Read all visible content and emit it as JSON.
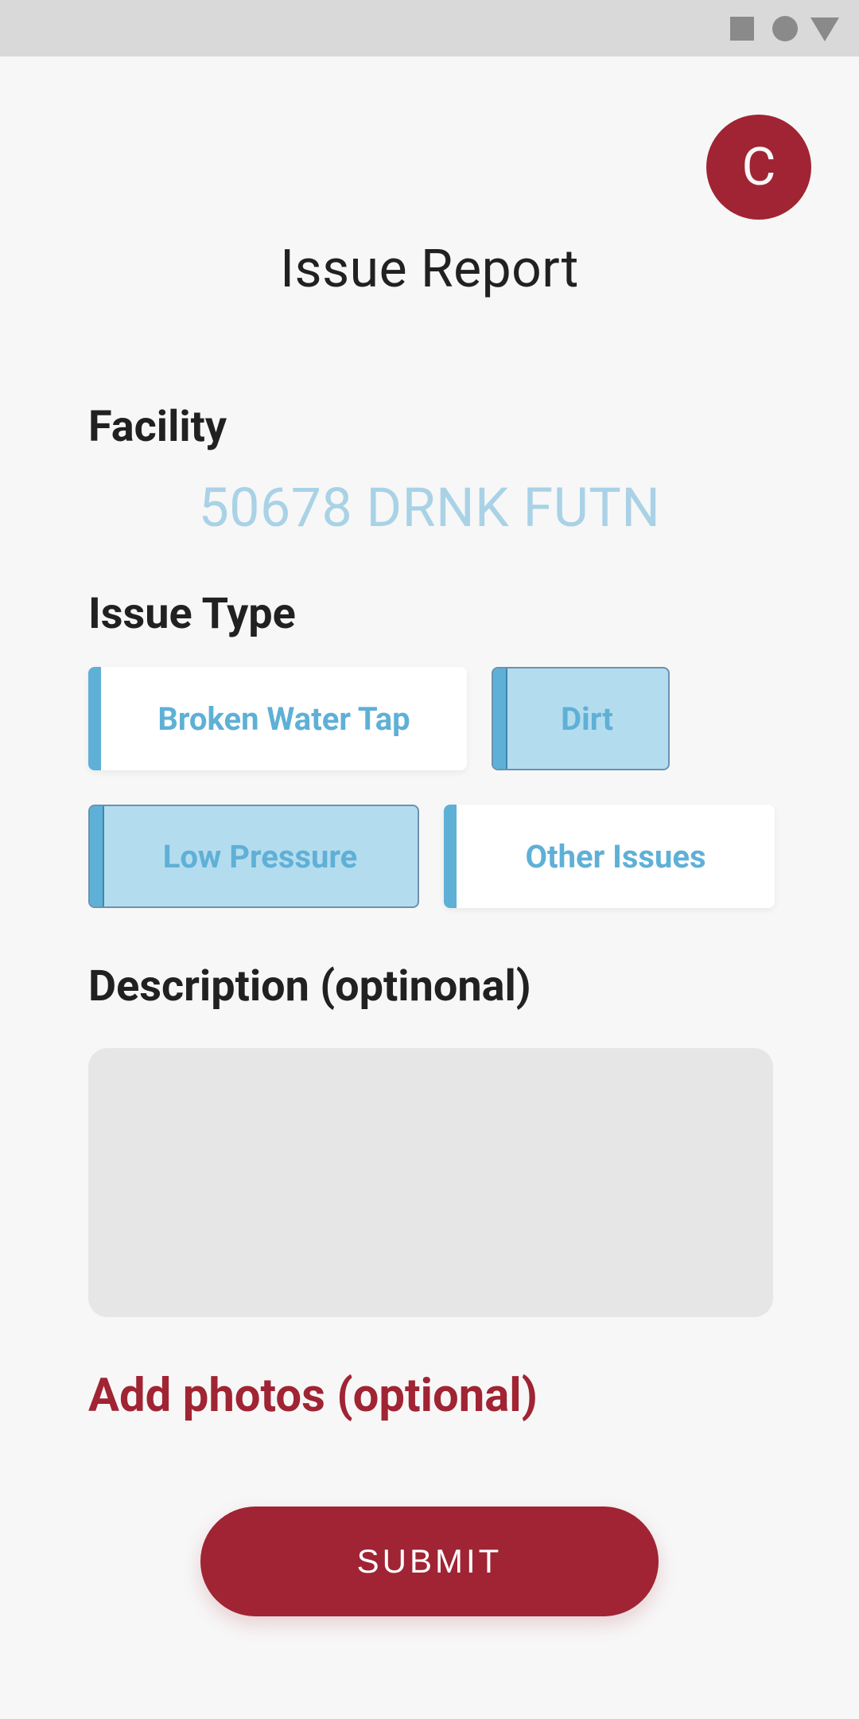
{
  "status_bar": {
    "icons": [
      "square-icon",
      "circle-icon",
      "triangle-icon"
    ]
  },
  "avatar": {
    "initial": "C"
  },
  "page": {
    "title": "Issue Report"
  },
  "facility": {
    "label": "Facility",
    "value": "50678 DRNK FUTN"
  },
  "issue_type": {
    "label": "Issue Type",
    "options": [
      {
        "label": "Broken Water Tap",
        "selected": false
      },
      {
        "label": "Dirt",
        "selected": true
      },
      {
        "label": "Low Pressure",
        "selected": true
      },
      {
        "label": "Other Issues",
        "selected": false
      }
    ]
  },
  "description": {
    "label": "Description (optinonal)",
    "value": ""
  },
  "photos": {
    "label": "Add photos (optional)"
  },
  "submit": {
    "label": "SUBMIT"
  },
  "colors": {
    "accent": "#a02433",
    "chip_text": "#5fb0d6",
    "chip_selected_bg": "#b4dcef",
    "facility_value": "#a9d2e6",
    "background": "#f7f7f7"
  }
}
